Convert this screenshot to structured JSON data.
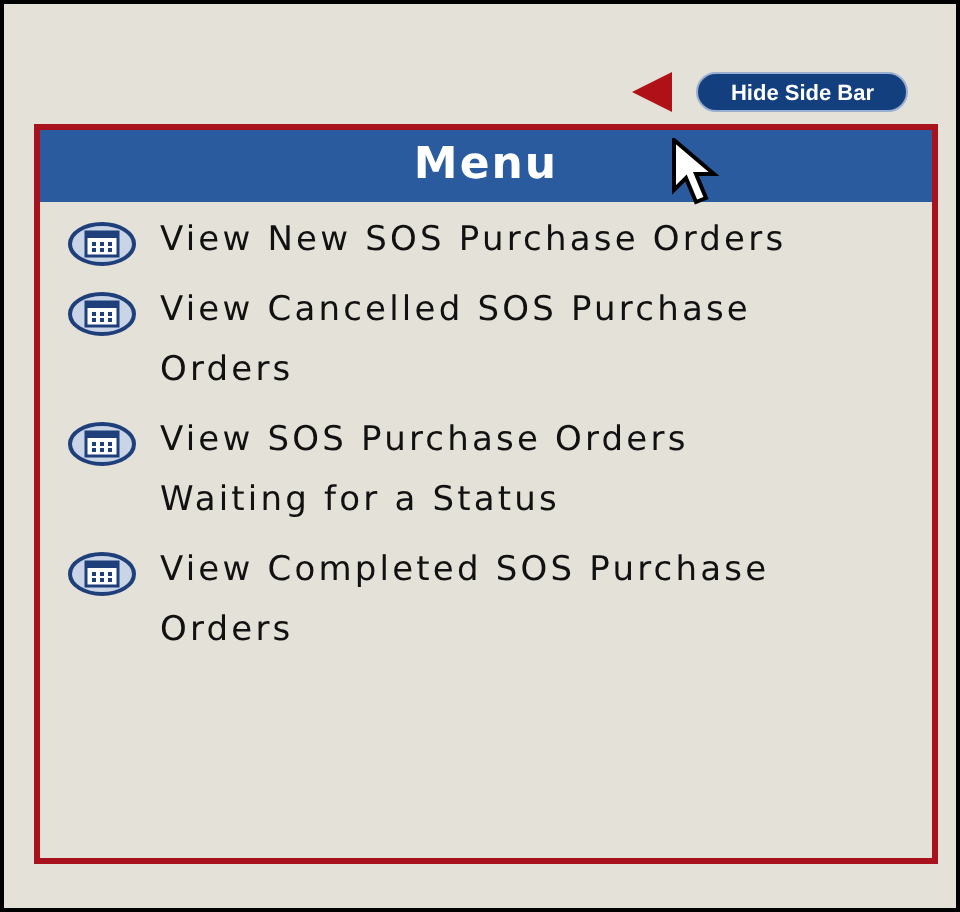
{
  "sidebar_toggle": {
    "label": "Hide Side Bar"
  },
  "menu": {
    "title": "Menu",
    "items": [
      {
        "label": "View New SOS Purchase Orders"
      },
      {
        "label": "View Cancelled SOS Purchase Orders"
      },
      {
        "label": "View SOS Purchase Orders Waiting for a Status"
      },
      {
        "label": "View Completed SOS Purchase Orders"
      }
    ]
  }
}
